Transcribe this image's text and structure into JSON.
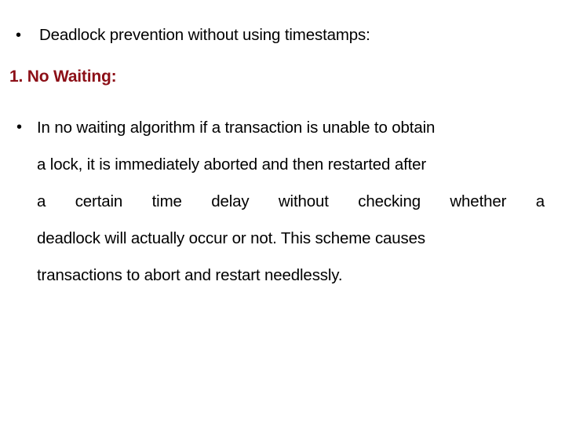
{
  "slide": {
    "background_color": "#FFFFFF",
    "text_color": "#000000",
    "heading_color": "#8C0F17",
    "bullet_glyph": "•",
    "lead_bullet": {
      "marker": "•",
      "text": "Deadlock prevention without using timestamps:"
    },
    "heading": {
      "text": "1. No Waiting:"
    },
    "body": {
      "marker": "•",
      "full_text": "In no waiting algorithm if a transaction is unable to obtain a lock, it is immediately aborted and then restarted after a certain time delay without checking whether a deadlock will actually occur or not. This scheme causes transactions to abort and restart needlessly.",
      "lines": [
        "In no waiting algorithm if a transaction is unable to obtain",
        "a lock, it is immediately aborted and then restarted after",
        "a certain time delay without checking whether a",
        "deadlock will actually occur or not. This scheme causes",
        "transactions to abort and restart needlessly."
      ],
      "line3_words": [
        "a",
        "certain",
        "time",
        "delay",
        "without",
        "checking",
        "whether",
        "a"
      ]
    }
  }
}
